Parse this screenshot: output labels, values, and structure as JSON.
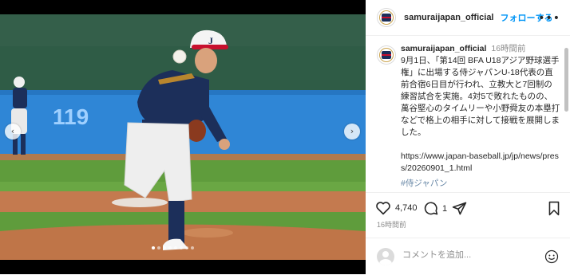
{
  "post": {
    "username": "samuraijapan_official",
    "follow_label": "フォローする",
    "more_label": "•••",
    "caption_time": "16時間前",
    "caption_body": "9月1日、「第14回 BFA U18アジア野球選手権」に出場する侍ジャパンU-18代表の直前合宿6日目が行われ、立教大と7回制の練習試合を実施。4対5で敗れたものの、萬谷堅心のタイムリーや小野舜友の本塁打などで格上の相手に対して接戦を展開しました。",
    "caption_link": "https://www.japan-baseball.jp/jp/news/press/20260901_1.html",
    "caption_tag": "#侍ジャパン",
    "likes": "4,740",
    "comments": "1",
    "posted_ago": "16時間前",
    "comment_placeholder": "コメントを追加...",
    "scoreboard_number": "119",
    "jersey_letter": "J"
  },
  "carousel": {
    "prev_glyph": "‹",
    "next_glyph": "›",
    "slide_count": 8,
    "active_slide": 1
  },
  "icons": {
    "heart": "heart-icon",
    "comment": "comment-icon",
    "share": "send-icon",
    "save": "bookmark-icon",
    "emoji": "emoji-icon",
    "logo": "samurai-japan-logo"
  },
  "colors": {
    "accent": "#0095f6",
    "text": "#262626",
    "muted": "#8e8e8e",
    "divider": "#efefef",
    "team_navy": "#1c2f5a",
    "team_red": "#c8102e",
    "field_blue": "#2f86d6"
  }
}
